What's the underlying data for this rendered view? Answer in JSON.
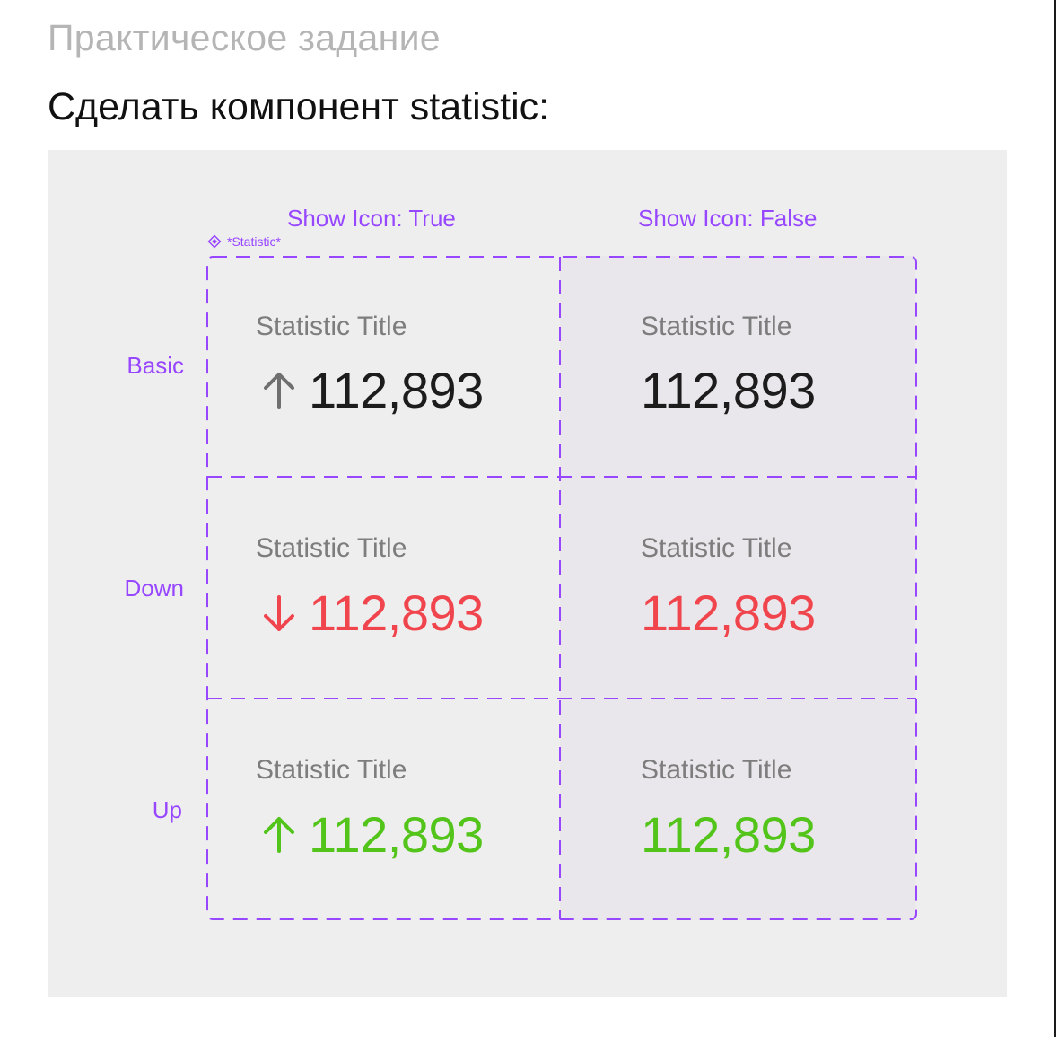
{
  "page": {
    "subtitle": "Практическое задание",
    "heading": "Сделать компонент statistic:"
  },
  "board": {
    "component_tag": "*Statistic*",
    "columns": [
      {
        "label": "Show Icon: True"
      },
      {
        "label": "Show Icon: False"
      }
    ],
    "rows": [
      {
        "label": "Basic"
      },
      {
        "label": "Down"
      },
      {
        "label": "Up"
      }
    ],
    "cells": {
      "basic_icon": {
        "title": "Statistic Title",
        "value": "112,893",
        "icon": "arrow-up-icon"
      },
      "basic_plain": {
        "title": "Statistic Title",
        "value": "112,893"
      },
      "down_icon": {
        "title": "Statistic Title",
        "value": "112,893",
        "icon": "arrow-down-icon"
      },
      "down_plain": {
        "title": "Statistic Title",
        "value": "112,893"
      },
      "up_icon": {
        "title": "Statistic Title",
        "value": "112,893",
        "icon": "arrow-up-icon"
      },
      "up_plain": {
        "title": "Statistic Title",
        "value": "112,893"
      }
    }
  },
  "colors": {
    "accent": "#9747ff",
    "basic": "#1c1c1c",
    "basic_icon": "#6f6f6f",
    "down": "#f0454d",
    "up": "#52c41a",
    "title": "#7d7d7d",
    "canvas": "#efeeef"
  }
}
